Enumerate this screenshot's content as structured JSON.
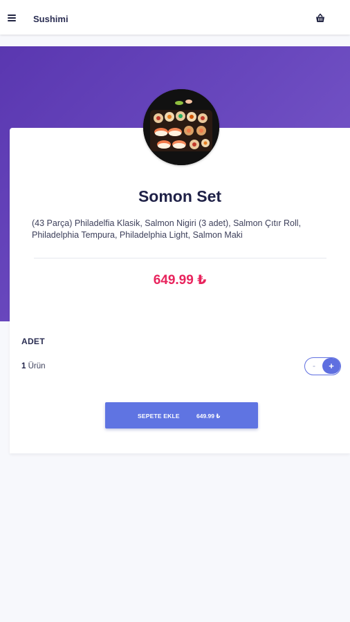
{
  "header": {
    "title": "Sushimi",
    "menu_icon": "hamburger-menu-icon",
    "cart_icon": "shopping-basket-icon"
  },
  "product": {
    "name": "Somon Set",
    "description": "(43 Parça) Philadelfia Klasik, Salmon Nigiri (3 adet), Salmon Çıtır Roll, Philadelphia Tempura, Philadelphia Light, Salmon Maki",
    "price": "649.99 ₺"
  },
  "quantity": {
    "heading": "ADET",
    "count": "1",
    "unit": "Ürün",
    "minus_label": "-",
    "plus_label": "+"
  },
  "add_to_cart": {
    "label": "SEPETE EKLE",
    "amount": "649.99 ₺"
  },
  "colors": {
    "accent": "#5f74e2",
    "price": "#e8245d",
    "hero_gradient_start": "#5a37b0",
    "hero_gradient_end": "#7c5ccc"
  }
}
